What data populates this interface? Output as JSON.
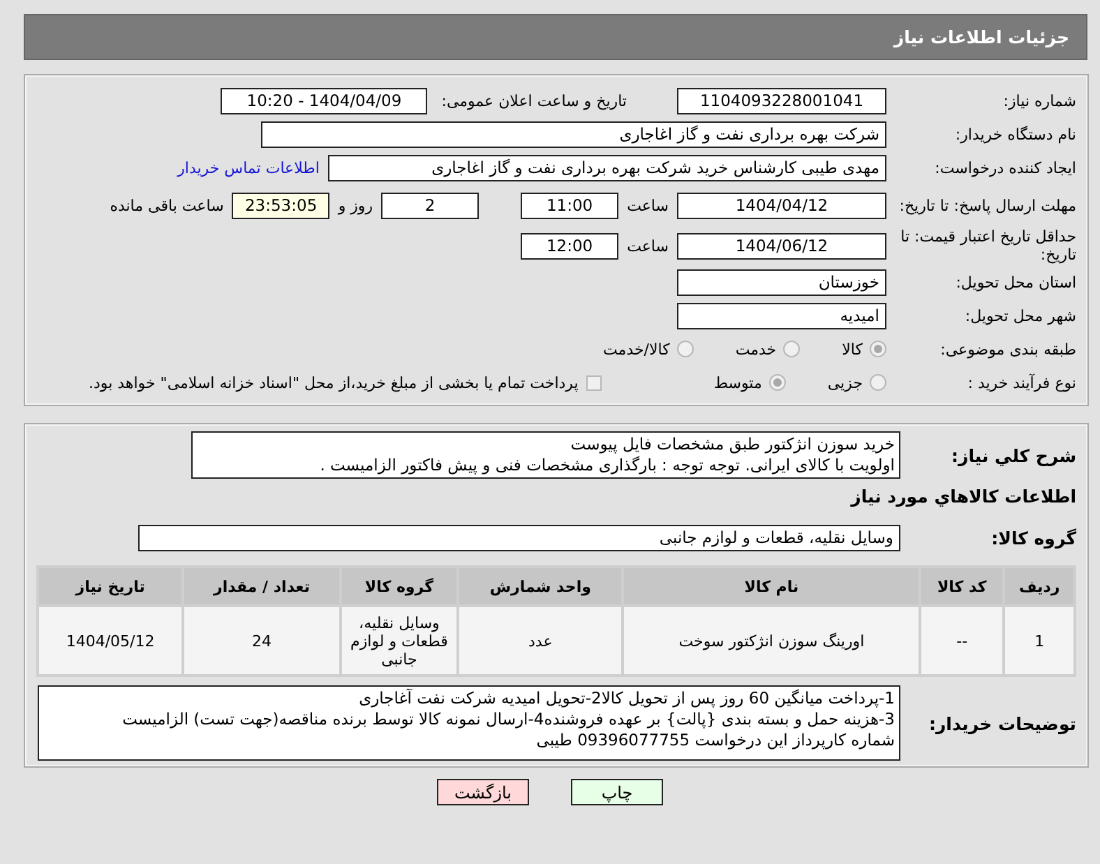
{
  "header": {
    "title": "جزئیات اطلاعات نیاز"
  },
  "need_number": {
    "label": "شماره نیاز:",
    "value": "1104093228001041"
  },
  "announce": {
    "label": "تاریخ و ساعت اعلان عمومی:",
    "value": "1404/04/09 - 10:20"
  },
  "buyer": {
    "label": "نام دستگاه خریدار:",
    "value": "شرکت بهره برداری نفت و گاز اغاجاری"
  },
  "creator": {
    "label": "ایجاد کننده درخواست:",
    "value": "مهدی طیبی کارشناس خرید شرکت بهره برداری نفت و گاز اغاجاری",
    "link": "اطلاعات تماس خریدار"
  },
  "deadline": {
    "label": "مهلت ارسال پاسخ: تا تاریخ:",
    "date": "1404/04/12",
    "time_label": "ساعت",
    "time": "11:00",
    "days": "2",
    "days_label": "روز و",
    "remaining": "23:53:05",
    "remaining_label": "ساعت باقی مانده"
  },
  "validity": {
    "label": "حداقل تاریخ اعتبار قیمت: تا تاریخ:",
    "date": "1404/06/12",
    "time_label": "ساعت",
    "time": "12:00"
  },
  "province": {
    "label": "استان محل تحویل:",
    "value": "خوزستان"
  },
  "city": {
    "label": "شهر محل تحویل:",
    "value": "امیدیه"
  },
  "category": {
    "label": "طبقه بندی موضوعی:",
    "options": [
      {
        "label": "کالا",
        "selected": true
      },
      {
        "label": "خدمت",
        "selected": false
      },
      {
        "label": "کالا/خدمت",
        "selected": false
      }
    ]
  },
  "process": {
    "label": "نوع فرآیند خرید :",
    "options": [
      {
        "label": "جزیی",
        "selected": false
      },
      {
        "label": "متوسط",
        "selected": true
      }
    ],
    "payment": {
      "label": "پرداخت تمام یا بخشی از مبلغ خرید،از محل \"اسناد خزانه اسلامی\" خواهد بود.",
      "checked": false
    }
  },
  "description": {
    "label": "شرح کلي نياز:",
    "lines": [
      "خرید سوزن انژکتور طبق مشخصات فایل پیوست",
      "اولویت با کالای ایرانی. توجه توجه : بارگذاری مشخصات فنی و پیش فاکتور الزامیست ."
    ]
  },
  "goods_title": "اطلاعات کالاهاي مورد نياز",
  "goods_group": {
    "label": "گروه کالا:",
    "value": "وسایل نقلیه، قطعات و لوازم جانبی"
  },
  "table": {
    "columns": [
      "ردیف",
      "کد کالا",
      "نام کالا",
      "واحد شمارش",
      "گروه کالا",
      "تعداد / مقدار",
      "تاریخ نیاز"
    ],
    "rows": [
      [
        "1",
        "--",
        "اورینگ سوزن انژکتور سوخت",
        "عدد",
        "وسایل نقلیه، قطعات و لوازم جانبی",
        "24",
        "1404/05/12"
      ]
    ]
  },
  "buyer_notes": {
    "label": "توضیحات خریدار:",
    "lines": [
      "1-پرداخت میانگین 60 روز پس از تحویل کالا2-تحویل امیدیه شرکت نفت آغاجاری",
      "3-هزینه حمل  و بسته بندی {پالت} بر عهده فروشنده4-ارسال نمونه کالا توسط برنده مناقصه(جهت تست) الزامیست",
      "شماره کارپرداز این درخواست 09396077755 طیبی"
    ]
  },
  "buttons": [
    {
      "kind": "print",
      "label": "چاپ"
    },
    {
      "kind": "back",
      "label": "بازگشت"
    }
  ]
}
